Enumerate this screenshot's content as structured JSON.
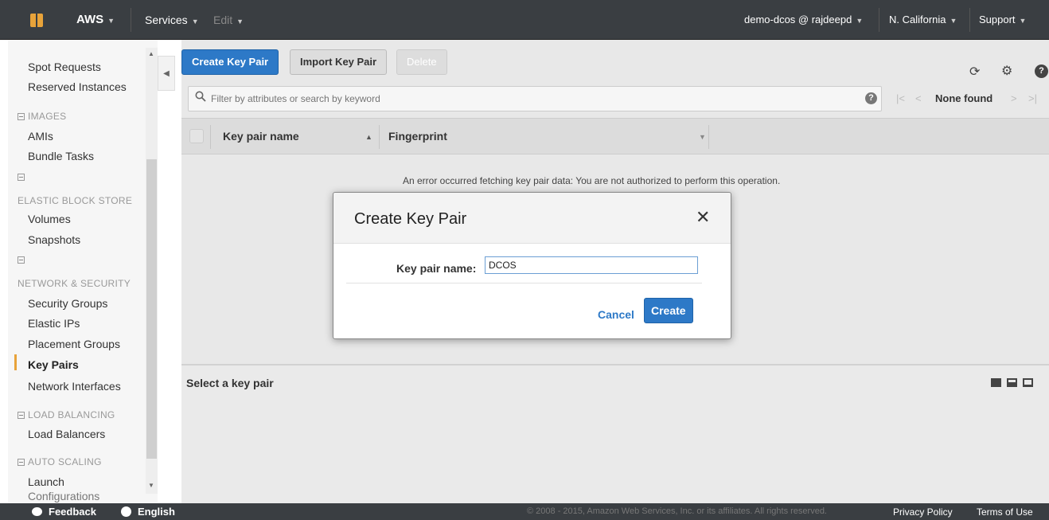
{
  "topbar": {
    "brand": "AWS",
    "services": "Services",
    "edit": "Edit",
    "user": "demo-dcos @ rajdeepd",
    "region": "N. California",
    "support": "Support"
  },
  "sidebar": {
    "items_top": [
      "Spot Requests",
      "Reserved Instances"
    ],
    "images_section": "IMAGES",
    "images_items": [
      "AMIs",
      "Bundle Tasks"
    ],
    "ebs_section": "ELASTIC BLOCK STORE",
    "ebs_items": [
      "Volumes",
      "Snapshots"
    ],
    "network_section": "NETWORK & SECURITY",
    "network_items": [
      "Security Groups",
      "Elastic IPs",
      "Placement Groups",
      "Key Pairs",
      "Network Interfaces"
    ],
    "lb_section": "LOAD BALANCING",
    "lb_items": [
      "Load Balancers"
    ],
    "as_section": "AUTO SCALING",
    "as_items": [
      "Launch",
      "Configurations"
    ]
  },
  "toolbar": {
    "create_label": "Create Key Pair",
    "import_label": "Import Key Pair",
    "delete_label": "Delete"
  },
  "search": {
    "placeholder": "Filter by attributes or search by keyword"
  },
  "pager": {
    "status": "None found"
  },
  "table": {
    "columns": [
      "Key pair name",
      "Fingerprint"
    ]
  },
  "error_message": "An error occurred fetching key pair data: You are not authorized to perform this operation.",
  "lower_panel": {
    "title": "Select a key pair"
  },
  "modal": {
    "title": "Create Key Pair",
    "field_label": "Key pair name:",
    "field_value": "DCOS",
    "cancel_label": "Cancel",
    "create_label": "Create"
  },
  "footer": {
    "feedback": "Feedback",
    "language": "English",
    "copyright": "© 2008 - 2015, Amazon Web Services, Inc. or its affiliates. All rights reserved.",
    "privacy": "Privacy Policy",
    "terms": "Terms of Use"
  },
  "colors": {
    "primary": "#2d79c7",
    "topbar": "#3a3e42",
    "accent": "#e8a33a"
  }
}
